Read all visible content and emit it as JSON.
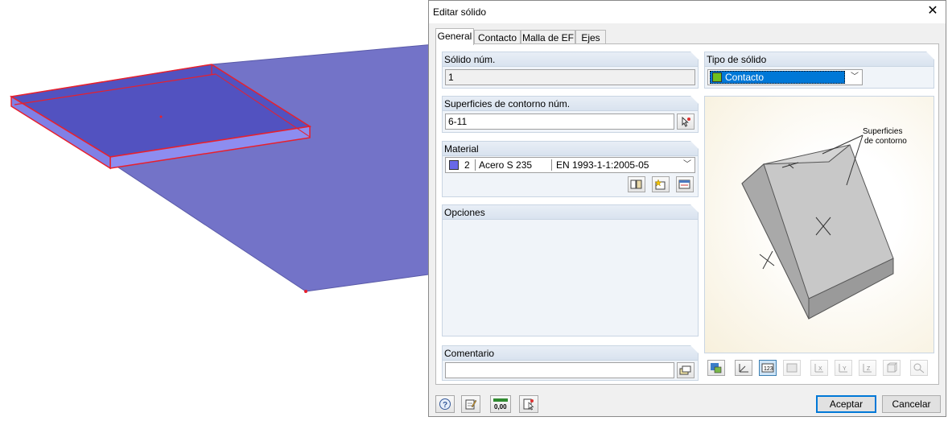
{
  "dialog": {
    "title": "Editar sólido",
    "tabs": [
      "General",
      "Contacto",
      "Malla de EF",
      "Ejes"
    ],
    "solid_no": {
      "label": "Sólido núm.",
      "value": "1"
    },
    "solid_type": {
      "label": "Tipo de sólido",
      "value": "Contacto",
      "swatch_color": "#6fbf1f"
    },
    "boundary": {
      "label": "Superficies de contorno núm.",
      "value": "6-11"
    },
    "material": {
      "label": "Material",
      "number": "2",
      "name": "Acero S 235",
      "standard": "EN 1993-1-1:2005-05",
      "swatch_color": "#6868e8"
    },
    "options": {
      "label": "Opciones"
    },
    "comment": {
      "label": "Comentario",
      "value": ""
    },
    "illustration": {
      "annotation_line1": "Superficies",
      "annotation_line2": "de contorno"
    },
    "buttons": {
      "ok": "Aceptar",
      "cancel": "Cancelar"
    },
    "icons": {
      "close": "close-icon",
      "pick": "pick-icon",
      "library": "library-icon",
      "new_material": "new-material-icon",
      "edit_material": "edit-material-icon",
      "comment_library": "comment-library-icon",
      "help": "help-icon",
      "edit": "edit-icon",
      "units": "units-icon",
      "info": "info-icon",
      "view_buttons": [
        "render-icon",
        "axes-icon",
        "numbering-icon",
        "dimension-icon",
        "view-x-icon",
        "view-y-icon",
        "view-z-icon",
        "iso-view-icon",
        "zoom-icon"
      ]
    },
    "units_label": "0,00"
  },
  "scene": {
    "plate_color": "#7373c8",
    "solid_color": "#5252c0",
    "edge_color": "#e8202c"
  }
}
